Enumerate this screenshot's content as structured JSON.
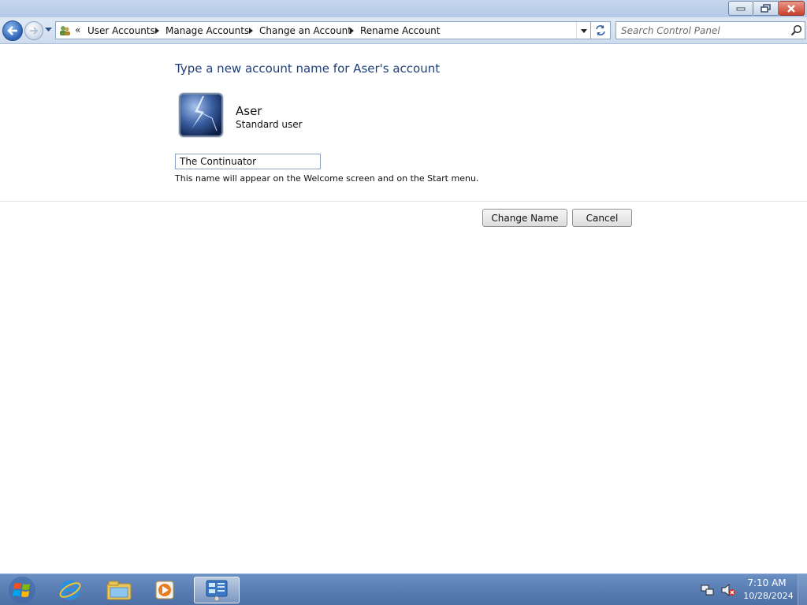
{
  "window": {
    "controls": [
      "minimize",
      "maximize",
      "close"
    ]
  },
  "nav": {
    "overflow_chevron": "«",
    "breadcrumbs": [
      "User Accounts",
      "Manage Accounts",
      "Change an Account",
      "Rename Account"
    ]
  },
  "search": {
    "placeholder": "Search Control Panel"
  },
  "main": {
    "heading": "Type a new account name for Aser's account",
    "account": {
      "name": "Aser",
      "type": "Standard user"
    },
    "name_input_value": "The Continuator",
    "hint": "This name will appear on the Welcome screen and on the Start menu.",
    "buttons": {
      "change_name": "Change Name",
      "cancel": "Cancel"
    }
  },
  "taskbar": {
    "pinned": [
      "internet-explorer-icon",
      "windows-explorer-icon",
      "media-player-icon",
      "control-panel-icon"
    ],
    "clock": {
      "time": "7:10 AM",
      "date": "10/28/2024"
    }
  },
  "colors": {
    "heading": "#1e3f7a",
    "taskbar": "#5a7eb4",
    "close_button": "#c7402a"
  }
}
